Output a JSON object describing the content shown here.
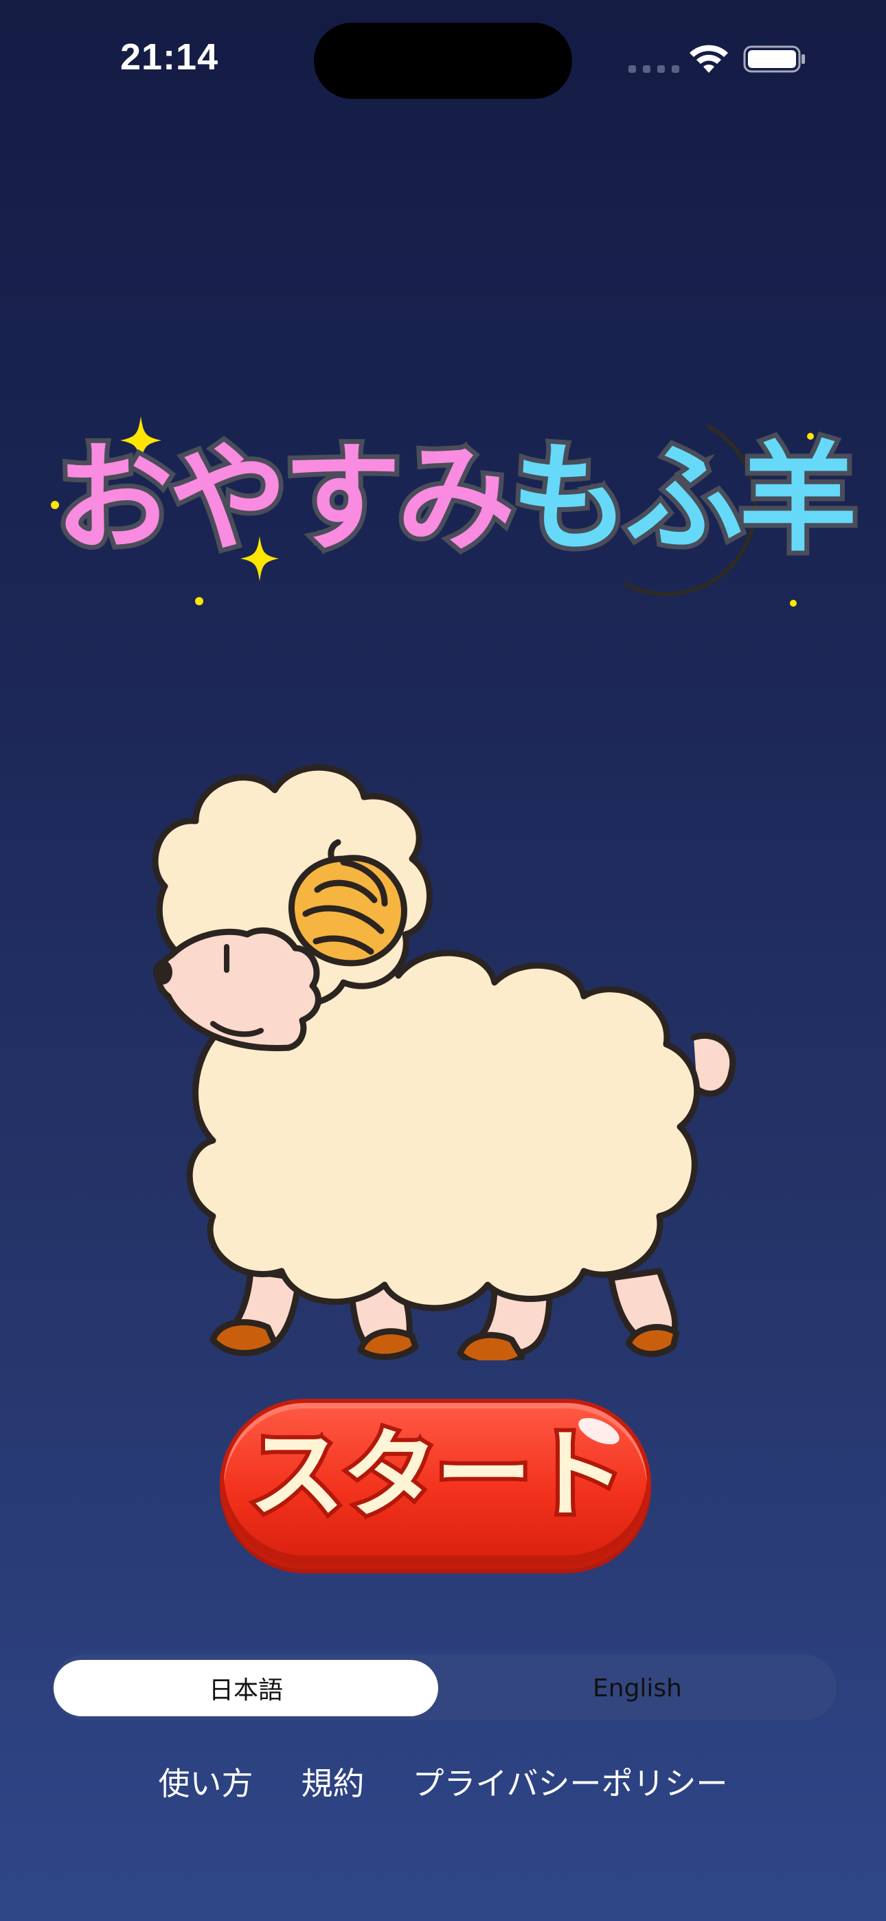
{
  "status_bar": {
    "time": "21:14",
    "icons": [
      "cellular-signal-icon",
      "wifi-icon",
      "battery-icon"
    ]
  },
  "logo": {
    "title_part_pink": "おやすみ",
    "title_part_blue": "もふ羊",
    "decorations": [
      "crescent-moon-icon",
      "sparkle-star-icon"
    ]
  },
  "illustration": {
    "icon": "sheep-icon"
  },
  "start_button": {
    "label": "スタート"
  },
  "language": {
    "options": [
      "日本語",
      "English"
    ],
    "selected": "日本語"
  },
  "footer": {
    "how_to_use": "使い方",
    "terms": "規約",
    "privacy_policy": "プライバシーポリシー"
  },
  "colors": {
    "background_top": "#141c44",
    "background_bottom": "#2f4688",
    "title_pink": "#f98be0",
    "title_blue": "#66d9f8",
    "start_button": "#f2321c",
    "sheep_wool": "#fdeccb",
    "moon": "#ffe600"
  }
}
